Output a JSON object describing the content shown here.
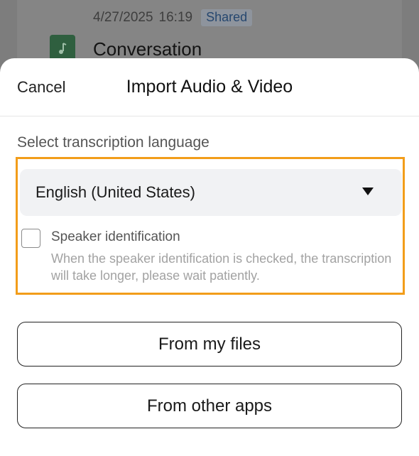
{
  "background": {
    "date": "4/27/2025",
    "time": "16:19",
    "badge": "Shared",
    "file_title": "Conversation",
    "file_icon": "music-note-icon"
  },
  "sheet": {
    "cancel_label": "Cancel",
    "title": "Import Audio & Video",
    "language_section_label": "Select transcription language",
    "selected_language": "English (United States)",
    "speaker_id_label": "Speaker identification",
    "speaker_id_checked": false,
    "speaker_id_hint": "When the speaker identification is checked, the transcription will take longer, please wait patiently.",
    "from_files_label": "From my files",
    "from_apps_label": "From other apps"
  },
  "colors": {
    "highlight": "#f29d1a",
    "badge_text": "#26476f",
    "file_icon": "#2f5f3f"
  }
}
